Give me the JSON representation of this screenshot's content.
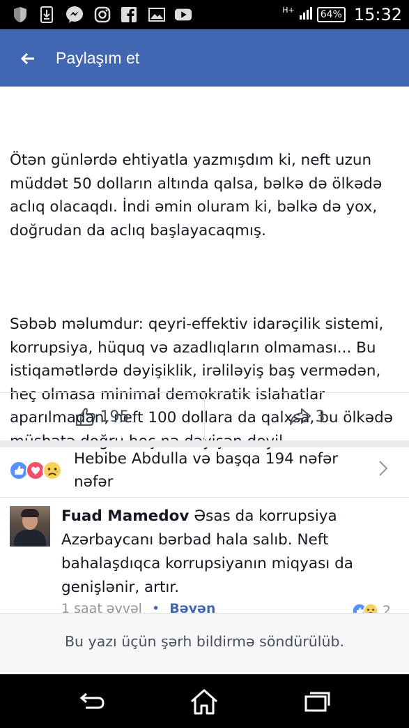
{
  "status_bar": {
    "time": "15:32",
    "battery": "64%",
    "network": "H+",
    "icons": [
      "shield-icon",
      "download-icon",
      "messenger-icon",
      "instagram-icon",
      "facebook-icon",
      "gallery-icon",
      "youtube-icon"
    ]
  },
  "app_bar": {
    "title": "Paylaşım et",
    "background": "#4267b2"
  },
  "post": {
    "paragraph_1": "Ötən günlərdə ehtiyatla yazmışdım ki, neft uzun müddət 50 dolların altında qalsa, bəlkə də ölkədə aclıq olacaqdı. İndi əmin oluram ki, bəlkə də yox, doğrudan da aclıq başlayacaqmış.",
    "paragraph_2": "Səbəb məlumdur: qeyri-effektiv idarəçilik sistemi, korrupsiya, hüquq və azadlıqların olmaması... Bu istiqamətlərdə dəyişiklik, irəliləyiş baş vermədən, heç olmasa minimal demokratik islahatlar aparılmadan, neft 100 dollara da qalxsa, bu ölkədə müsbətə doğru heç nə dəyişən deyil."
  },
  "actions": {
    "like_count": "195",
    "share_count": "3"
  },
  "reactions": {
    "summary": "Hebibe Abdulla və başqa 194 nəfər nəfər",
    "icons": [
      "like-icon",
      "love-icon",
      "sad-icon"
    ]
  },
  "comment": {
    "author": "Fuad Mamedov",
    "text": "Əsas da korrupsiya Azərbaycanı bərbad hala salıb. Neft bahalaşdıqca korrupsiyanın miqyası da genişlənir, artır.",
    "time": "1 saat əvvəl",
    "separator": "•",
    "action": "Bəyən",
    "reaction_count": "2"
  },
  "disabled_notice": "Bu yazı üçün şərh bildirmə söndürülüb.",
  "nav": {
    "icons": [
      "back-icon",
      "home-icon",
      "recent-apps-icon"
    ]
  }
}
